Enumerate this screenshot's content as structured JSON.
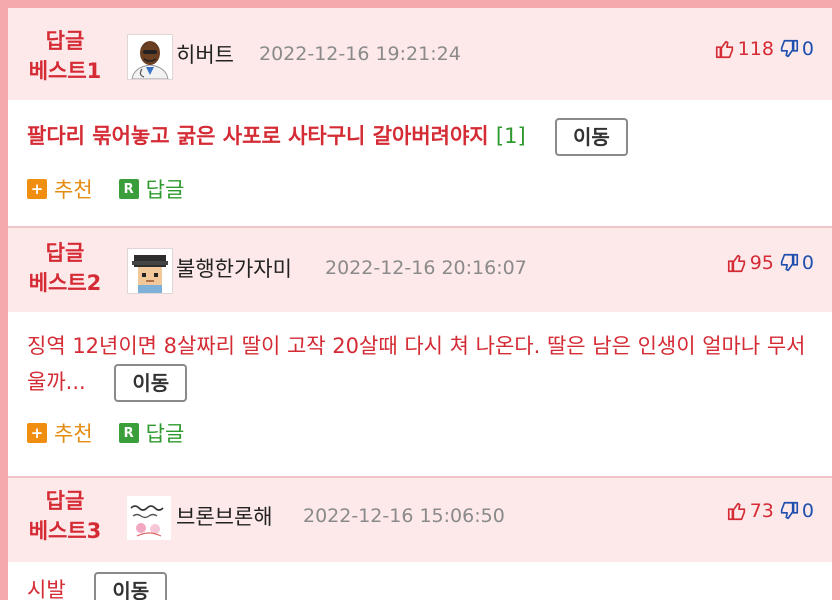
{
  "posts": [
    {
      "badge_line1": "답글",
      "badge_line2": "베스트1",
      "nickname": "히버트",
      "timestamp": "2022-12-16 19:21:24",
      "upvotes": "118",
      "downvotes": "0",
      "content": "팔다리 묶어놓고 굵은 사포로 사타구니 갈아버려야지",
      "reply_count": "[1]",
      "move_label": "이동",
      "recommend_label": "추천",
      "reply_label": "답글",
      "avatar": "cartoon-doctor-avatar"
    },
    {
      "badge_line1": "답글",
      "badge_line2": "베스트2",
      "nickname": "불행한가자미",
      "timestamp": "2022-12-16 20:16:07",
      "upvotes": "95",
      "downvotes": "0",
      "content": "징역 12년이면 8살짜리 딸이 고작 20살때 다시 쳐 나온다. 딸은 남은 인생이 얼마나 무서울까...",
      "move_label": "이동",
      "recommend_label": "추천",
      "reply_label": "답글",
      "avatar": "pixel-character-avatar"
    },
    {
      "badge_line1": "답글",
      "badge_line2": "베스트3",
      "nickname": "브론브론해",
      "timestamp": "2022-12-16 15:06:50",
      "upvotes": "73",
      "downvotes": "0",
      "content": "시발",
      "move_label": "이동",
      "avatar": "handwritten-sticker-avatar"
    }
  ],
  "colors": {
    "accent_red": "#d42b35",
    "header_bg": "#fde9ea",
    "frame_pink": "#f5a9ac",
    "recommend_orange": "#f08e12",
    "reply_green": "#3a9e3a",
    "downvote_blue": "#1f4fae"
  }
}
